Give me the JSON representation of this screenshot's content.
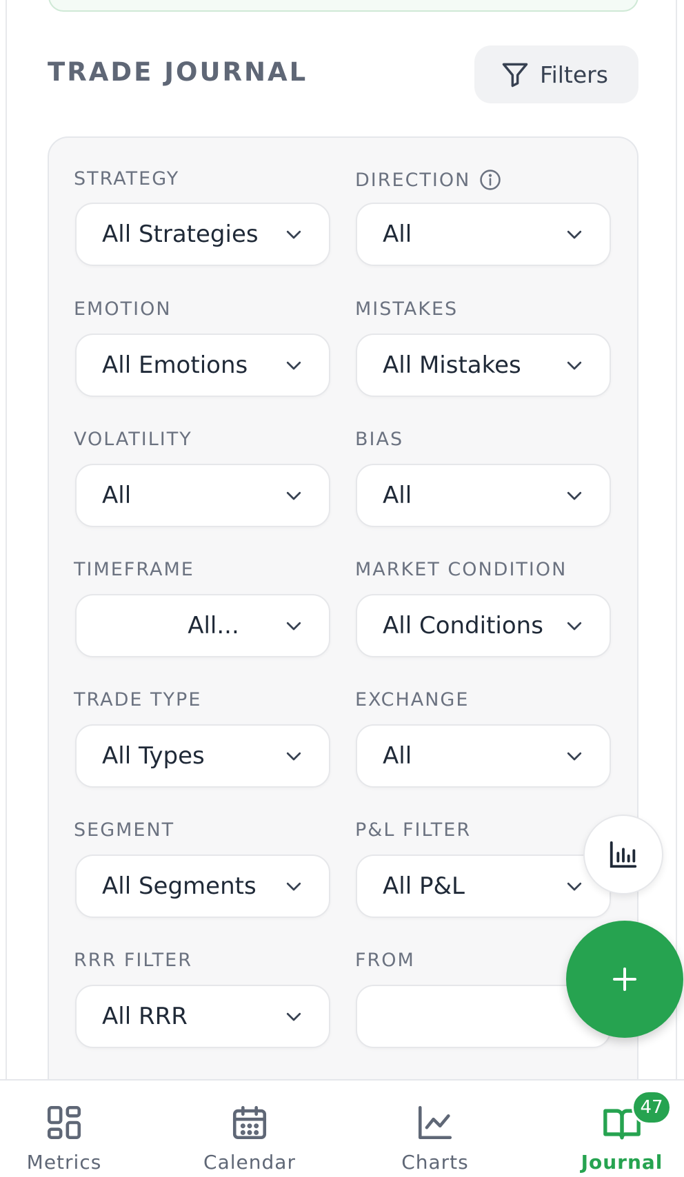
{
  "section": {
    "title": "TRADE JOURNAL",
    "filters_label": "Filters"
  },
  "filters": [
    {
      "label": "STRATEGY",
      "value": "All Strategies"
    },
    {
      "label": "DIRECTION",
      "value": "All",
      "info": true
    },
    {
      "label": "EMOTION",
      "value": "All Emotions"
    },
    {
      "label": "MISTAKES",
      "value": "All Mistakes"
    },
    {
      "label": "VOLATILITY",
      "value": "All"
    },
    {
      "label": "BIAS",
      "value": "All"
    },
    {
      "label": "TIMEFRAME",
      "value": "All..."
    },
    {
      "label": "MARKET CONDITION",
      "value": "All Conditions"
    },
    {
      "label": "TRADE TYPE",
      "value": "All Types"
    },
    {
      "label": "EXCHANGE",
      "value": "All"
    },
    {
      "label": "SEGMENT",
      "value": "All Segments"
    },
    {
      "label": "P&L FILTER",
      "value": "All P&L"
    },
    {
      "label": "RRR FILTER",
      "value": "All RRR"
    },
    {
      "label": "FROM",
      "value": ""
    }
  ],
  "nav": {
    "items": [
      {
        "label": "Metrics",
        "icon": "grid-icon"
      },
      {
        "label": "Calendar",
        "icon": "calendar-icon"
      },
      {
        "label": "Charts",
        "icon": "line-chart-icon"
      },
      {
        "label": "Journal",
        "icon": "book-icon",
        "active": true,
        "badge": "47"
      }
    ]
  },
  "colors": {
    "accent": "#26a350",
    "muted_text": "#6b7280",
    "panel_bg": "#f7f7f8"
  }
}
